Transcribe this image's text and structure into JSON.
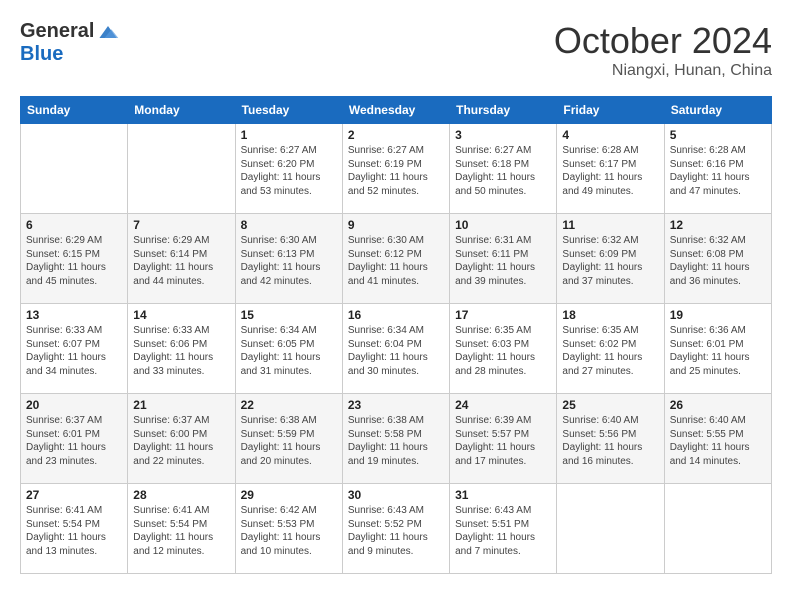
{
  "logo": {
    "general": "General",
    "blue": "Blue"
  },
  "title": "October 2024",
  "subtitle": "Niangxi, Hunan, China",
  "weekdays": [
    "Sunday",
    "Monday",
    "Tuesday",
    "Wednesday",
    "Thursday",
    "Friday",
    "Saturday"
  ],
  "weeks": [
    [
      {
        "day": "",
        "sunrise": "",
        "sunset": "",
        "daylight": ""
      },
      {
        "day": "",
        "sunrise": "",
        "sunset": "",
        "daylight": ""
      },
      {
        "day": "1",
        "sunrise": "Sunrise: 6:27 AM",
        "sunset": "Sunset: 6:20 PM",
        "daylight": "Daylight: 11 hours and 53 minutes."
      },
      {
        "day": "2",
        "sunrise": "Sunrise: 6:27 AM",
        "sunset": "Sunset: 6:19 PM",
        "daylight": "Daylight: 11 hours and 52 minutes."
      },
      {
        "day": "3",
        "sunrise": "Sunrise: 6:27 AM",
        "sunset": "Sunset: 6:18 PM",
        "daylight": "Daylight: 11 hours and 50 minutes."
      },
      {
        "day": "4",
        "sunrise": "Sunrise: 6:28 AM",
        "sunset": "Sunset: 6:17 PM",
        "daylight": "Daylight: 11 hours and 49 minutes."
      },
      {
        "day": "5",
        "sunrise": "Sunrise: 6:28 AM",
        "sunset": "Sunset: 6:16 PM",
        "daylight": "Daylight: 11 hours and 47 minutes."
      }
    ],
    [
      {
        "day": "6",
        "sunrise": "Sunrise: 6:29 AM",
        "sunset": "Sunset: 6:15 PM",
        "daylight": "Daylight: 11 hours and 45 minutes."
      },
      {
        "day": "7",
        "sunrise": "Sunrise: 6:29 AM",
        "sunset": "Sunset: 6:14 PM",
        "daylight": "Daylight: 11 hours and 44 minutes."
      },
      {
        "day": "8",
        "sunrise": "Sunrise: 6:30 AM",
        "sunset": "Sunset: 6:13 PM",
        "daylight": "Daylight: 11 hours and 42 minutes."
      },
      {
        "day": "9",
        "sunrise": "Sunrise: 6:30 AM",
        "sunset": "Sunset: 6:12 PM",
        "daylight": "Daylight: 11 hours and 41 minutes."
      },
      {
        "day": "10",
        "sunrise": "Sunrise: 6:31 AM",
        "sunset": "Sunset: 6:11 PM",
        "daylight": "Daylight: 11 hours and 39 minutes."
      },
      {
        "day": "11",
        "sunrise": "Sunrise: 6:32 AM",
        "sunset": "Sunset: 6:09 PM",
        "daylight": "Daylight: 11 hours and 37 minutes."
      },
      {
        "day": "12",
        "sunrise": "Sunrise: 6:32 AM",
        "sunset": "Sunset: 6:08 PM",
        "daylight": "Daylight: 11 hours and 36 minutes."
      }
    ],
    [
      {
        "day": "13",
        "sunrise": "Sunrise: 6:33 AM",
        "sunset": "Sunset: 6:07 PM",
        "daylight": "Daylight: 11 hours and 34 minutes."
      },
      {
        "day": "14",
        "sunrise": "Sunrise: 6:33 AM",
        "sunset": "Sunset: 6:06 PM",
        "daylight": "Daylight: 11 hours and 33 minutes."
      },
      {
        "day": "15",
        "sunrise": "Sunrise: 6:34 AM",
        "sunset": "Sunset: 6:05 PM",
        "daylight": "Daylight: 11 hours and 31 minutes."
      },
      {
        "day": "16",
        "sunrise": "Sunrise: 6:34 AM",
        "sunset": "Sunset: 6:04 PM",
        "daylight": "Daylight: 11 hours and 30 minutes."
      },
      {
        "day": "17",
        "sunrise": "Sunrise: 6:35 AM",
        "sunset": "Sunset: 6:03 PM",
        "daylight": "Daylight: 11 hours and 28 minutes."
      },
      {
        "day": "18",
        "sunrise": "Sunrise: 6:35 AM",
        "sunset": "Sunset: 6:02 PM",
        "daylight": "Daylight: 11 hours and 27 minutes."
      },
      {
        "day": "19",
        "sunrise": "Sunrise: 6:36 AM",
        "sunset": "Sunset: 6:01 PM",
        "daylight": "Daylight: 11 hours and 25 minutes."
      }
    ],
    [
      {
        "day": "20",
        "sunrise": "Sunrise: 6:37 AM",
        "sunset": "Sunset: 6:01 PM",
        "daylight": "Daylight: 11 hours and 23 minutes."
      },
      {
        "day": "21",
        "sunrise": "Sunrise: 6:37 AM",
        "sunset": "Sunset: 6:00 PM",
        "daylight": "Daylight: 11 hours and 22 minutes."
      },
      {
        "day": "22",
        "sunrise": "Sunrise: 6:38 AM",
        "sunset": "Sunset: 5:59 PM",
        "daylight": "Daylight: 11 hours and 20 minutes."
      },
      {
        "day": "23",
        "sunrise": "Sunrise: 6:38 AM",
        "sunset": "Sunset: 5:58 PM",
        "daylight": "Daylight: 11 hours and 19 minutes."
      },
      {
        "day": "24",
        "sunrise": "Sunrise: 6:39 AM",
        "sunset": "Sunset: 5:57 PM",
        "daylight": "Daylight: 11 hours and 17 minutes."
      },
      {
        "day": "25",
        "sunrise": "Sunrise: 6:40 AM",
        "sunset": "Sunset: 5:56 PM",
        "daylight": "Daylight: 11 hours and 16 minutes."
      },
      {
        "day": "26",
        "sunrise": "Sunrise: 6:40 AM",
        "sunset": "Sunset: 5:55 PM",
        "daylight": "Daylight: 11 hours and 14 minutes."
      }
    ],
    [
      {
        "day": "27",
        "sunrise": "Sunrise: 6:41 AM",
        "sunset": "Sunset: 5:54 PM",
        "daylight": "Daylight: 11 hours and 13 minutes."
      },
      {
        "day": "28",
        "sunrise": "Sunrise: 6:41 AM",
        "sunset": "Sunset: 5:54 PM",
        "daylight": "Daylight: 11 hours and 12 minutes."
      },
      {
        "day": "29",
        "sunrise": "Sunrise: 6:42 AM",
        "sunset": "Sunset: 5:53 PM",
        "daylight": "Daylight: 11 hours and 10 minutes."
      },
      {
        "day": "30",
        "sunrise": "Sunrise: 6:43 AM",
        "sunset": "Sunset: 5:52 PM",
        "daylight": "Daylight: 11 hours and 9 minutes."
      },
      {
        "day": "31",
        "sunrise": "Sunrise: 6:43 AM",
        "sunset": "Sunset: 5:51 PM",
        "daylight": "Daylight: 11 hours and 7 minutes."
      },
      {
        "day": "",
        "sunrise": "",
        "sunset": "",
        "daylight": ""
      },
      {
        "day": "",
        "sunrise": "",
        "sunset": "",
        "daylight": ""
      }
    ]
  ]
}
